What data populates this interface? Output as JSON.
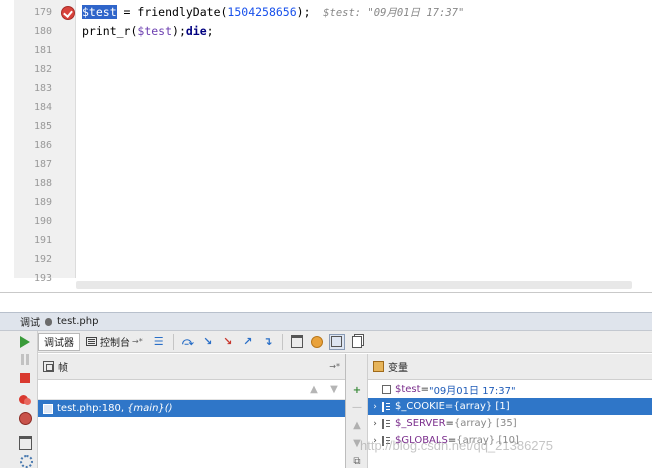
{
  "editor": {
    "line_numbers": [
      "179",
      "180",
      "181",
      "182",
      "183",
      "184",
      "185",
      "186",
      "187",
      "188",
      "189",
      "190",
      "191",
      "192",
      "193"
    ],
    "line179": {
      "var": "$test",
      "assign": " = ",
      "func": "friendlyDate(",
      "arg": "1504258656",
      "close": ");",
      "hint": "  $test: \"09月01日 17:37\""
    },
    "line180": {
      "func": "print_r(",
      "arg": "$test",
      "close": ");",
      "kw": "die",
      "end": ";"
    }
  },
  "debug": {
    "title_prefix": "调试",
    "title_file": "test.php",
    "tabs": {
      "debugger": "调试器",
      "console": "控制台",
      "console_pin": "→*"
    },
    "toolbar_buttons": [
      "show-execution-point",
      "step-over",
      "step-into",
      "force-step-into",
      "step-out",
      "run-to-cursor",
      "evaluate-expression",
      "watch",
      "show-values",
      "copy-stack"
    ]
  },
  "frames": {
    "title": "帧",
    "pin": "→*",
    "rows": [
      {
        "location": "test.php:180,",
        "context": "{main}()"
      }
    ]
  },
  "variables": {
    "title": "变量",
    "rows": [
      {
        "name": "$test",
        "eq": " = ",
        "value": "\"09月01日 17:37\"",
        "type": "",
        "expanded": false,
        "leaf": true
      },
      {
        "name": "$_COOKIE",
        "eq": " = ",
        "value": "",
        "type": "{array} [1]",
        "expanded": false,
        "leaf": false
      },
      {
        "name": "$_SERVER",
        "eq": " = ",
        "value": "",
        "type": "{array} [35]",
        "expanded": false,
        "leaf": false
      },
      {
        "name": "$GLOBALS",
        "eq": " = ",
        "value": "",
        "type": "{array} [10]",
        "expanded": false,
        "leaf": false
      }
    ]
  },
  "watermark": "http://blog.csdn.net/qq_21386275",
  "colors": {
    "selection": "#2f76c8",
    "breakpoint": "#d8433c",
    "number": "#1750eb",
    "variable": "#6c3fb0"
  }
}
